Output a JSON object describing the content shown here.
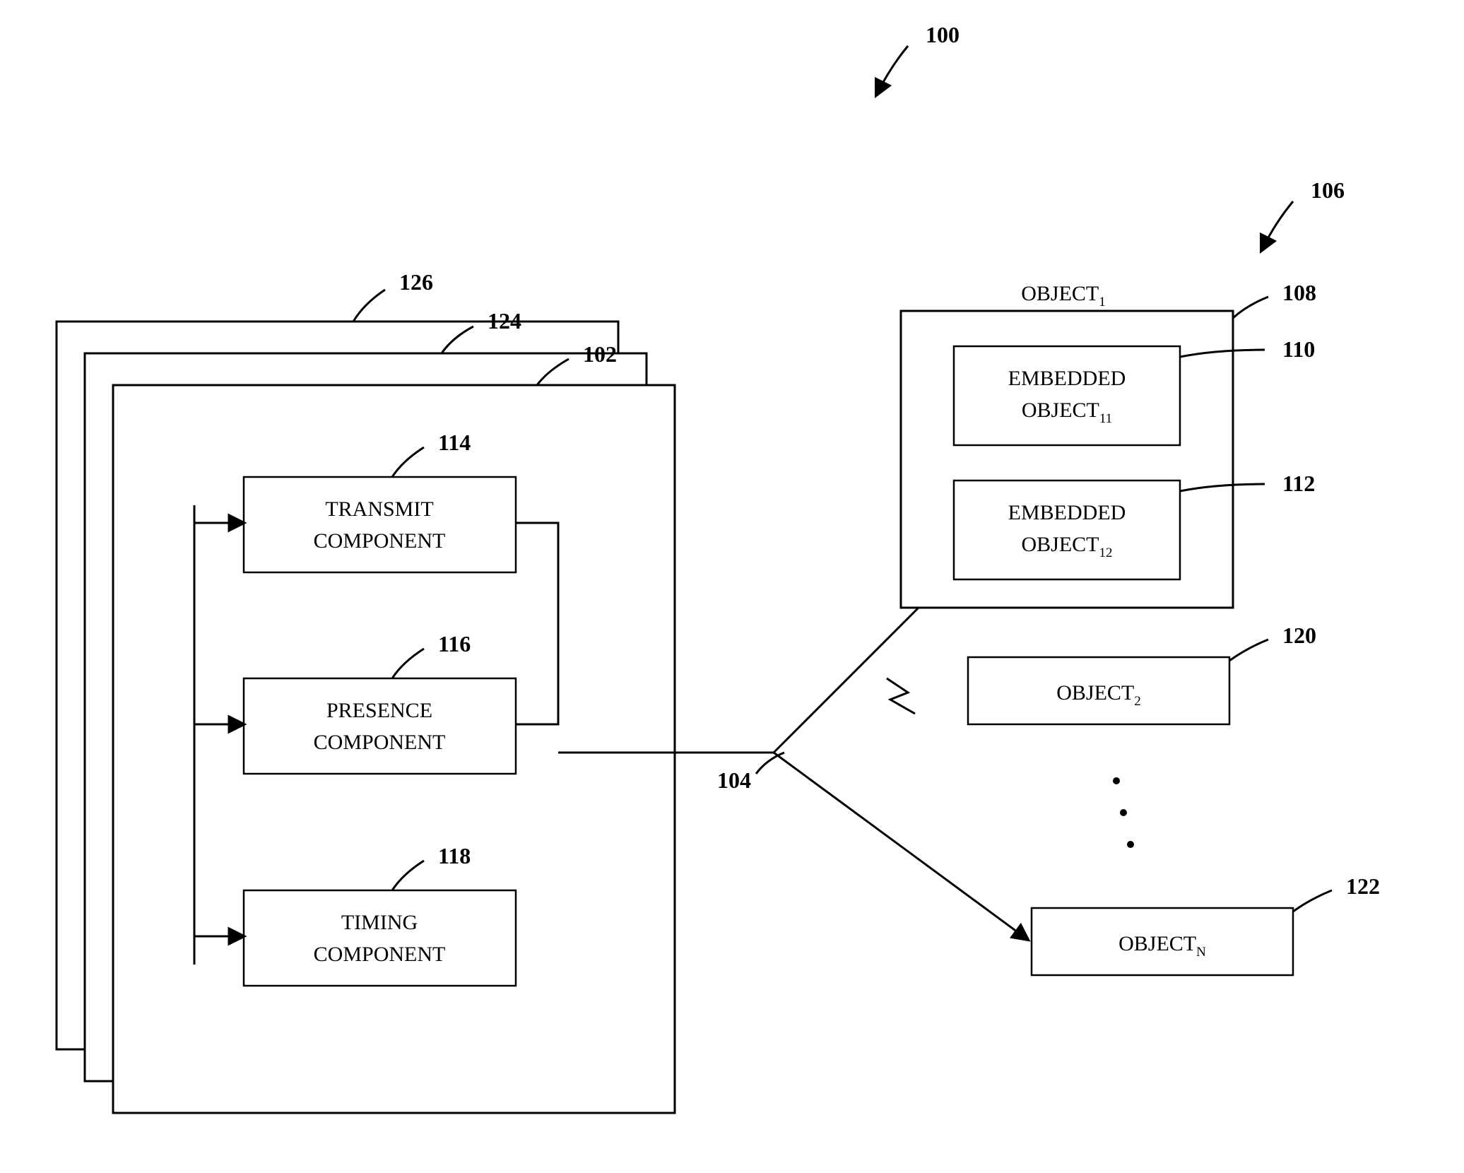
{
  "fig_ref": "100",
  "group_ref": "106",
  "stack": {
    "back_ref": "126",
    "mid_ref": "124",
    "front_ref": "102"
  },
  "components": {
    "transmit": {
      "text_l1": "TRANSMIT",
      "text_l2": "COMPONENT",
      "ref": "114"
    },
    "presence": {
      "text_l1": "PRESENCE",
      "text_l2": "COMPONENT",
      "ref": "116"
    },
    "timing": {
      "text_l1": "TIMING",
      "text_l2": "COMPONENT",
      "ref": "118"
    }
  },
  "link_ref": "104",
  "object1": {
    "title_pre": "OBJECT",
    "title_sub": "1",
    "ref": "108",
    "emb1": {
      "l1": "EMBEDDED",
      "l2_pre": "OBJECT",
      "l2_sub": "11",
      "ref": "110"
    },
    "emb2": {
      "l1": "EMBEDDED",
      "l2_pre": "OBJECT",
      "l2_sub": "12",
      "ref": "112"
    }
  },
  "object2": {
    "pre": "OBJECT",
    "sub": "2",
    "ref": "120"
  },
  "objectN": {
    "pre": "OBJECT",
    "sub": "N",
    "ref": "122"
  }
}
